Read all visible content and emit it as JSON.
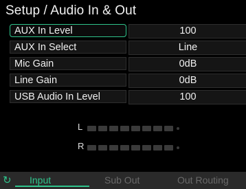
{
  "page": {
    "title": "Setup / Audio In & Out"
  },
  "settings": [
    {
      "label": "AUX In Level",
      "value": "100"
    },
    {
      "label": "AUX In Select",
      "value": "Line"
    },
    {
      "label": "Mic Gain",
      "value": "0dB"
    },
    {
      "label": "Line Gain",
      "value": "0dB"
    },
    {
      "label": "USB Audio In Level",
      "value": "100"
    }
  ],
  "meters": {
    "left_label": "L",
    "right_label": "R"
  },
  "tabs": {
    "icon": "refresh-icon",
    "items": [
      {
        "label": "Input"
      },
      {
        "label": "Sub Out"
      },
      {
        "label": "Out Routing"
      }
    ]
  },
  "colors": {
    "accent": "#2fc48c"
  }
}
